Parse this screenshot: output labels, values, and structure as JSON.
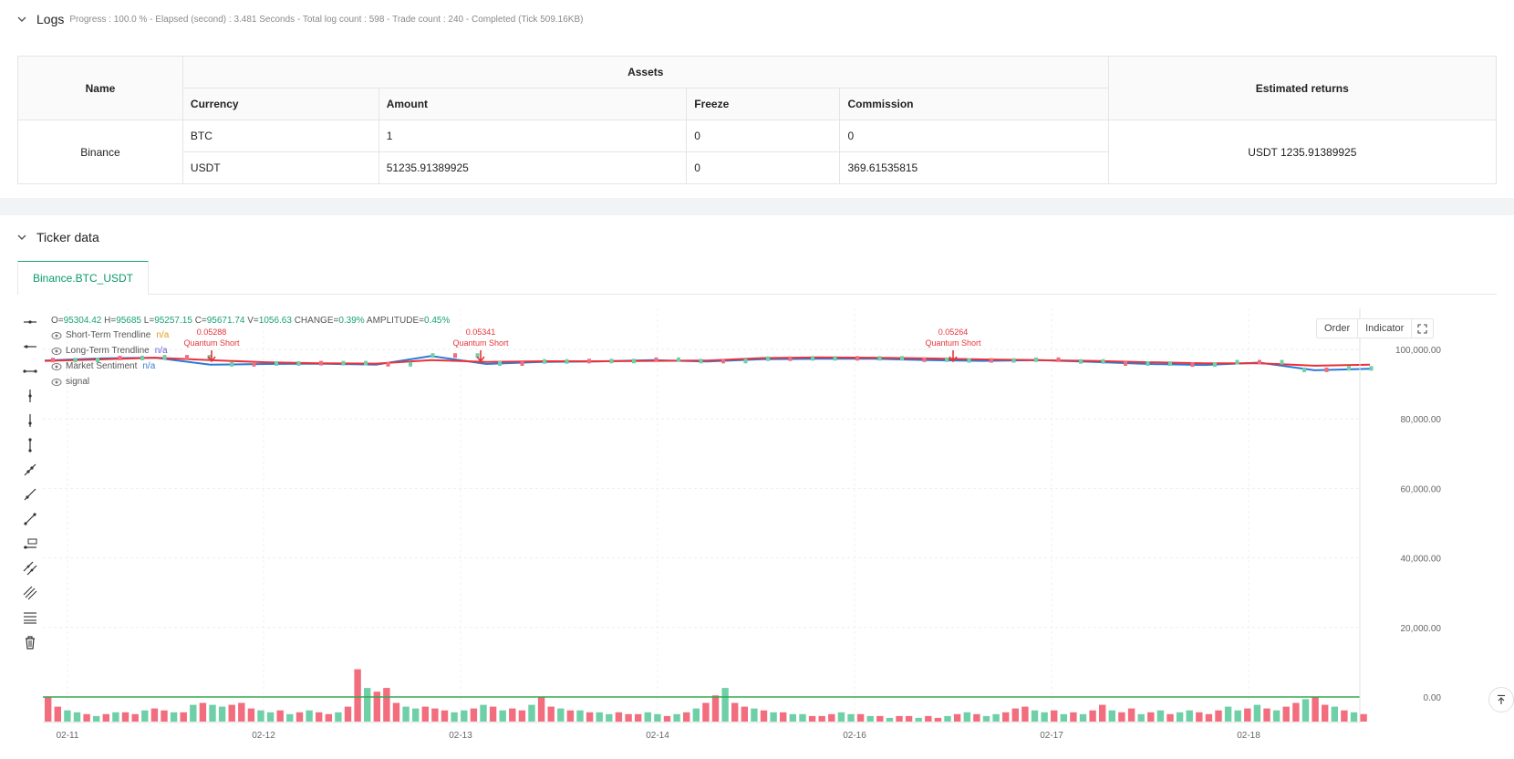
{
  "logs": {
    "title": "Logs",
    "meta": "Progress : 100.0 % - Elapsed (second) : 3.481  Seconds - Total log count : 598 - Trade count : 240 - Completed (Tick 509.16KB)"
  },
  "assets_table": {
    "name_header": "Name",
    "assets_header": "Assets",
    "returns_header": "Estimated returns",
    "columns": [
      "Currency",
      "Amount",
      "Freeze",
      "Commission"
    ],
    "exchange": "Binance",
    "rows": [
      {
        "currency": "BTC",
        "amount": "1",
        "freeze": "0",
        "commission": "0"
      },
      {
        "currency": "USDT",
        "amount": "51235.91389925",
        "freeze": "0",
        "commission": "369.61535815"
      }
    ],
    "estimated_returns": "USDT 1235.91389925"
  },
  "ticker": {
    "title": "Ticker data",
    "tab": "Binance.BTC_USDT"
  },
  "ohlc": {
    "o_label": "O=",
    "o": "95304.42",
    "h_label": "H=",
    "h": "95685",
    "l_label": "L=",
    "l": "95257.15",
    "c_label": "C=",
    "c": "95671.74",
    "v_label": "V=",
    "v": "1056.63",
    "change_label": "CHANGE=",
    "change": "0.39%",
    "amp_label": "AMPLITUDE=",
    "amp": "0.45%"
  },
  "legend": {
    "short": "Short-Term Trendline",
    "short_val": "n/a",
    "long": "Long-Term Trendline",
    "long_val": "n/a",
    "sentiment": "Market Sentiment",
    "sentiment_val": "n/a",
    "signal": "signal"
  },
  "buttons": {
    "order": "Order",
    "indicator": "Indicator"
  },
  "colors": {
    "up": "#6fd0a8",
    "down": "#f26d7d",
    "short_line": "#2b7bd8",
    "long_line": "#e8333a",
    "baseline": "#35a853",
    "accent": "#0a9a6c"
  },
  "chart_data": {
    "type": "line",
    "x_ticks": [
      "02-11",
      "02-12",
      "02-13",
      "02-14",
      "02-16",
      "02-17",
      "02-18"
    ],
    "y_ticks": [
      "100,000.00",
      "80,000.00",
      "60,000.00",
      "40,000.00",
      "20,000.00",
      "0.00"
    ],
    "ylim": [
      -10000,
      110000
    ],
    "grid": true,
    "annotations": [
      {
        "value": "0.05288",
        "label": "Quantum Short"
      },
      {
        "value": "0.05341",
        "label": "Quantum Short"
      },
      {
        "value": "0.05264",
        "label": "Quantum Short"
      }
    ],
    "series": [
      {
        "name": "Short-Term Trendline",
        "values": [
          96800,
          97400,
          97600,
          95600,
          95800,
          95900,
          95600,
          98100,
          95800,
          96400,
          96500,
          96900,
          96500,
          97200,
          97300,
          97300,
          96900,
          96700,
          96900,
          96400,
          95800,
          95500,
          96200,
          94000,
          94400
        ]
      },
      {
        "name": "Long-Term Trendline",
        "values": [
          96700,
          97100,
          97600,
          96900,
          96300,
          96000,
          95900,
          96900,
          96400,
          96600,
          96600,
          96700,
          96800,
          97500,
          97700,
          97600,
          97400,
          97100,
          96900,
          96700,
          96300,
          96000,
          96000,
          95300,
          95600
        ]
      }
    ],
    "volume": [
      13,
      8,
      6,
      5,
      4,
      3,
      4,
      5,
      5,
      4,
      6,
      7,
      6,
      5,
      5,
      9,
      10,
      9,
      8,
      9,
      10,
      7,
      6,
      5,
      6,
      4,
      5,
      6,
      5,
      4,
      5,
      8,
      28,
      18,
      16,
      18,
      10,
      8,
      7,
      8,
      7,
      6,
      5,
      6,
      7,
      9,
      8,
      6,
      7,
      6,
      9,
      13,
      8,
      7,
      6,
      6,
      5,
      5,
      4,
      5,
      4,
      4,
      5,
      4,
      3,
      4,
      5,
      7,
      10,
      14,
      18,
      10,
      8,
      7,
      6,
      5,
      5,
      4,
      4,
      3,
      3,
      4,
      5,
      4,
      4,
      3,
      3,
      2,
      3,
      3,
      2,
      3,
      2,
      3,
      4,
      5,
      4,
      3,
      4,
      5,
      7,
      8,
      6,
      5,
      6,
      4,
      5,
      4,
      6,
      9,
      6,
      5,
      7,
      4,
      5,
      6,
      4,
      5,
      6,
      5,
      4,
      6,
      8,
      6,
      7,
      9,
      7,
      6,
      8,
      10,
      12,
      13,
      9,
      8,
      6,
      5,
      4
    ]
  }
}
